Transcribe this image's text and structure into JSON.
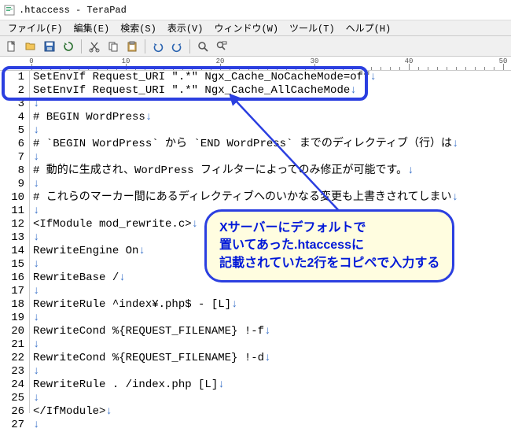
{
  "window": {
    "title": ".htaccess - TeraPad"
  },
  "menu": {
    "file": "ファイル(F)",
    "edit": "編集(E)",
    "search": "検索(S)",
    "view": "表示(V)",
    "window": "ウィンドウ(W)",
    "tool": "ツール(T)",
    "help": "ヘルプ(H)"
  },
  "ruler": {
    "ticks": [
      0,
      10,
      20,
      30,
      40,
      50
    ]
  },
  "lines": [
    "SetEnvIf Request_URI \".*\" Ngx_Cache_NoCacheMode=off",
    "SetEnvIf Request_URI \".*\" Ngx_Cache_AllCacheMode",
    "",
    "# BEGIN WordPress",
    "",
    "# `BEGIN WordPress` から `END WordPress` までのディレクティブ（行）は",
    "",
    "# 動的に生成され、WordPress フィルターによってのみ修正が可能です。",
    "",
    "# これらのマーカー間にあるディレクティブへのいかなる変更も上書きされてしまい",
    "",
    "<IfModule mod_rewrite.c>",
    "",
    "RewriteEngine On",
    "",
    "RewriteBase /",
    "",
    "RewriteRule ^index¥.php$ - [L]",
    "",
    "RewriteCond %{REQUEST_FILENAME} !-f",
    "",
    "RewriteCond %{REQUEST_FILENAME} !-d",
    "",
    "RewriteRule . /index.php [L]",
    "",
    "</IfModule>",
    ""
  ],
  "callout": {
    "l1": "Xサーバーにデフォルトで",
    "l2": "置いてあった.htaccessに",
    "l3": "記載されていた2行をコピペで入力する"
  }
}
